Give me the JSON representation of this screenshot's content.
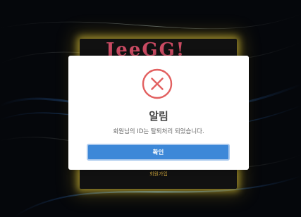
{
  "background": {
    "logo_text": "JeeGG!",
    "signup_link": "회원가입"
  },
  "alert": {
    "icon": "close-circle-icon",
    "icon_color": "#e26060",
    "title": "알림",
    "message": "회원님의 ID는 탈퇴처리 되었습니다.",
    "confirm_label": "확인",
    "confirm_color": "#3d88d8"
  }
}
